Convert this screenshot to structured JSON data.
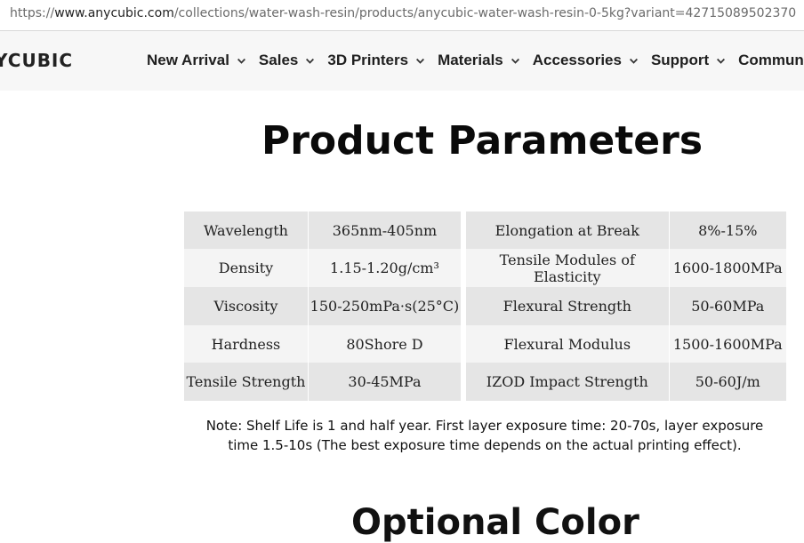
{
  "browser": {
    "url_prefix": "https://",
    "url_host": "www.anycubic.com",
    "url_path": "/collections/water-wash-resin/products/anycubic-water-wash-resin-0-5kg?variant=42715089502370"
  },
  "header": {
    "logo_text": "YCUBIC",
    "menu": [
      {
        "label": "New Arrival"
      },
      {
        "label": "Sales"
      },
      {
        "label": "3D Printers"
      },
      {
        "label": "Materials"
      },
      {
        "label": "Accessories"
      },
      {
        "label": "Support"
      },
      {
        "label": "Community"
      }
    ]
  },
  "main": {
    "title": "Product Parameters",
    "left_table": [
      {
        "name": "Wavelength",
        "value": "365nm-405nm"
      },
      {
        "name": "Density",
        "value": "1.15-1.20g/cm³"
      },
      {
        "name": "Viscosity",
        "value": "150-250mPa·s(25°C)"
      },
      {
        "name": "Hardness",
        "value": "80Shore D"
      },
      {
        "name": "Tensile Strength",
        "value": "30-45MPa"
      }
    ],
    "right_table": [
      {
        "name": "Elongation at Break",
        "value": "8%-15%"
      },
      {
        "name": "Tensile Modules of Elasticity",
        "value": "1600-1800MPa"
      },
      {
        "name": "Flexural Strength",
        "value": "50-60MPa"
      },
      {
        "name": "Flexural Modulus",
        "value": "1500-1600MPa"
      },
      {
        "name": "IZOD Impact Strength",
        "value": "50-60J/m"
      }
    ],
    "note": "Note: Shelf Life is 1 and half year. First layer exposure time: 20-70s, layer exposure time 1.5-10s (The best exposure time depends on the actual printing effect).",
    "next_heading": "Optional Color"
  }
}
